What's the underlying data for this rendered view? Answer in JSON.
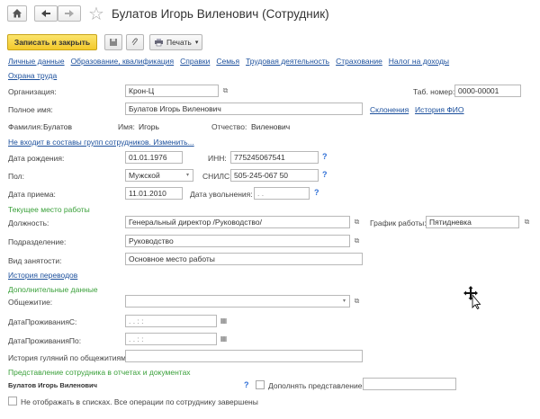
{
  "header": {
    "title": "Булатов Игорь Виленович (Сотрудник)",
    "star": "☆",
    "home_icon": "home-icon",
    "back_icon": "back-arrow-icon",
    "forward_icon": "forward-arrow-icon"
  },
  "toolbar": {
    "save_close": "Записать и закрыть",
    "print": "Печать",
    "print_arrow": "▾"
  },
  "tabs": [
    "Личные данные",
    "Образование, квалификация",
    "Справки",
    "Семья",
    "Трудовая деятельность",
    "Страхование",
    "Налог на доходы"
  ],
  "tab_second_row": "Охрана труда",
  "fields": {
    "org_label": "Организация:",
    "org_value": "Крон-Ц",
    "tab_num_label": "Таб. номер:",
    "tab_num_value": "0000-00001",
    "fullname_label": "Полное имя:",
    "fullname_value": "Булатов Игорь Виленович",
    "declensions": "Склонения",
    "fio_history": "История ФИО",
    "surname_label": "Фамилия:",
    "surname_value": "Булатов",
    "name_label": "Имя:",
    "name_value": "Игорь",
    "patronymic_label": "Отчество:",
    "patronymic_value": "Виленович",
    "groups_link": "Не входит в составы групп сотрудников. Изменить...",
    "birth_label": "Дата рождения:",
    "birth_value": "01.01.1976",
    "inn_label": "ИНН:",
    "inn_value": "775245067541",
    "gender_label": "Пол:",
    "gender_value": "Мужской",
    "snils_label": "СНИЛС:",
    "snils_value": "505-245-067 50",
    "hire_label": "Дата приема:",
    "hire_value": "11.01.2010",
    "dismiss_label": "Дата увольнения:",
    "dismiss_value": ". .",
    "question": "?"
  },
  "work": {
    "section": "Текущее место работы",
    "position_label": "Должность:",
    "position_value": "Генеральный директор /Руководство/",
    "schedule_label": "График работы:",
    "schedule_value": "Пятидневка",
    "dept_label": "Подразделение:",
    "dept_value": "Руководство",
    "employment_label": "Вид занятости:",
    "employment_value": "Основное место работы",
    "transfers_link": "История переводов"
  },
  "extra": {
    "section": "Дополнительные данные",
    "dorm_label": "Общежитие:",
    "from_label": "ДатаПроживанияС:",
    "from_value": ". .   : :",
    "to_label": "ДатаПроживанияПо:",
    "to_value": ". .   : :",
    "history_label": "История гуляний по  общежитиям:"
  },
  "representation": {
    "section": "Представление сотрудника в отчетах и документах",
    "value": "Булатов Игорь Виленович",
    "supplement": "Дополнять представление",
    "hide_label": "Не отображать в списках. Все операции по сотруднику завершены"
  },
  "colors": {
    "link": "#1b4f9c",
    "section": "#3aa03a",
    "primary": "#f3c92c"
  }
}
